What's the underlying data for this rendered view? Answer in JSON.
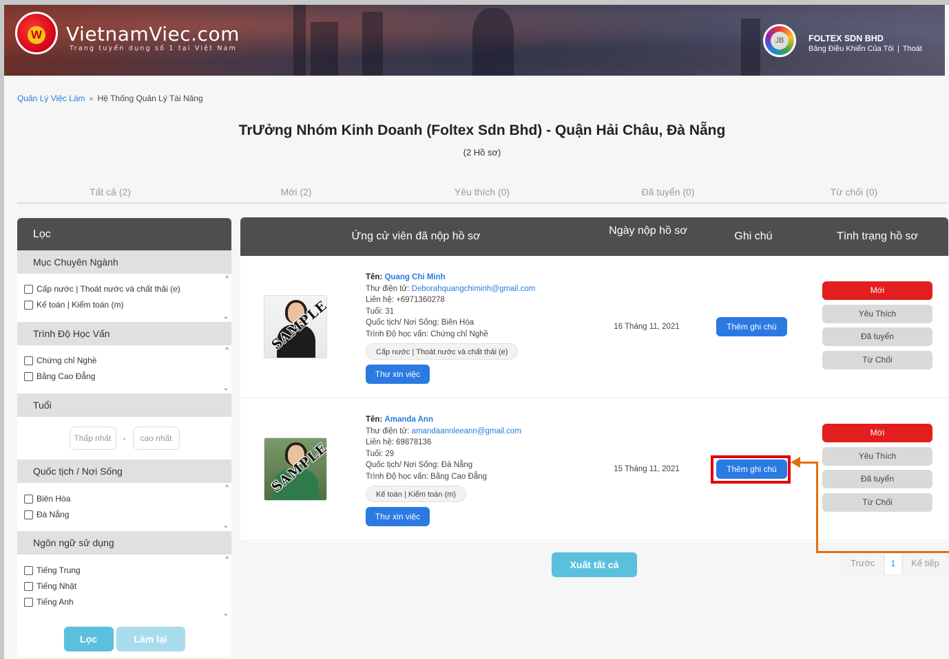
{
  "header": {
    "logo_text": "VietnamViec.com",
    "logo_tagline": "Trang tuyển dụng số 1 tại Việt Nam",
    "logo_letter": "W",
    "company_avatar_text": "JB",
    "company_name": "FOLTEX SDN BHD",
    "dashboard_link": "Bảng Điều Khiển Của Tôi",
    "link_separator": "|",
    "logout_link": "Thoát"
  },
  "breadcrumb": {
    "parent": "Quản Lý Việc Làm",
    "separator": "»",
    "current": "Hệ Thống Quản Lý Tài Năng"
  },
  "job": {
    "title": "TrƯởng Nhóm Kinh Doanh (Foltex Sdn Bhd) - Quận Hải Châu, Đà Nẵng",
    "count": "(2 Hồ sơ)"
  },
  "tabs": [
    "Tất cả (2)",
    "Mới (2)",
    "Yêu thích (0)",
    "Đã tuyển (0)",
    "Từ chối (0)"
  ],
  "filter": {
    "title": "Lọc",
    "sections": [
      {
        "title": "Mục Chuyên Ngành",
        "items": [
          "Cấp nước | Thoát nước và chất thải (e)",
          "Kế toán | Kiểm toán (m)"
        ]
      },
      {
        "title": "Trình Độ Học Vấn",
        "items": [
          "Chứng chỉ Nghề",
          "Bằng Cao Đẳng"
        ]
      },
      {
        "title": "Tuổi",
        "min_placeholder": "Thấp nhất",
        "dash": "-",
        "max_placeholder": "cao nhất"
      },
      {
        "title": "Quốc tịch / Nơi Sống",
        "items": [
          "Biên Hòa",
          "Đà Nẵng"
        ]
      },
      {
        "title": "Ngôn ngữ sử dụng",
        "items": [
          "Tiếng Trung",
          "Tiếng Nhật",
          "Tiếng Anh"
        ]
      }
    ],
    "scroll_up": "^",
    "scroll_down": "⌄",
    "filter_button": "Lọc",
    "reset_button": "Làm lại"
  },
  "table": {
    "headers": {
      "candidate": "Ứng cử viên đã nộp hồ sơ",
      "date": "Ngày nộp hồ sơ",
      "note": "Ghi chú",
      "status": "Tình trạng hồ sơ"
    },
    "rows": [
      {
        "name_label": "Tên:",
        "name": "Quang Chi Minh",
        "email_label": "Thư điện tử:",
        "email": "Deborahquangchiminh@gmail.com",
        "phone": "Liên hệ: +6971360278",
        "age": "Tuổi: 31",
        "location": "Quốc tịch/ Nơi Sống: Biên Hòa",
        "education": "Trình Độ học vấn: Chứng chỉ Nghề",
        "tag": "Cấp nước | Thoát nước và chất thải (e)",
        "letter_button": "Thư xin việc",
        "date": "16 Tháng 11, 2021",
        "note_button": "Thêm ghi chú",
        "photo_stamp": "SAMPLE",
        "statuses": [
          "Mới",
          "Yêu Thích",
          "Đã tuyển",
          "Từ Chối"
        ]
      },
      {
        "name_label": "Tên:",
        "name": "Amanda Ann",
        "email_label": "Thư điện tử:",
        "email": "amandaannleeann@gmail.com",
        "phone": "Liên hệ: 69878136",
        "age": "Tuổi: 29",
        "location": "Quốc tịch/ Nơi Sống: Đà Nẵng",
        "education": "Trình Độ học vấn: Bằng Cao Đẳng",
        "tag": "Kế toán | Kiểm toán (m)",
        "letter_button": "Thư xin việc",
        "date": "15 Tháng 11, 2021",
        "note_button": "Thêm ghi chú",
        "photo_stamp": "SAMPLE",
        "statuses": [
          "Mới",
          "Yêu Thích",
          "Đã tuyển",
          "Từ Chối"
        ]
      }
    ]
  },
  "export_button": "Xuất tất cả",
  "pagination": {
    "prev": "Trước",
    "current": "1",
    "next": "Kế tiếp"
  },
  "colors": {
    "accent_blue": "#2a7ae2",
    "status_new_red": "#e31e1e",
    "annotation_red": "#e30000",
    "annotation_arrow": "#e46f10",
    "cyan_button": "#5bc0de"
  }
}
